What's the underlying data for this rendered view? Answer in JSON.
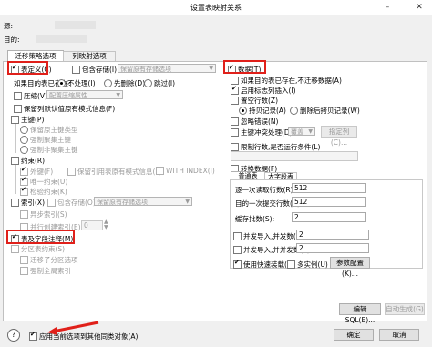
{
  "window": {
    "title": "设置表映射关系",
    "close_icon": "close-icon",
    "minimize_icon": "minimize-icon"
  },
  "header": {
    "source_label": "源:",
    "source_value": "",
    "target_label": "目的:",
    "target_value": ""
  },
  "tabs": [
    {
      "label": "迁移策略选项"
    },
    {
      "label": "列映射选项"
    }
  ],
  "left": {
    "table_def": {
      "label": "表定义(C)",
      "checked": true
    },
    "include_storage": {
      "label": "包含存储(I)",
      "select": "保留原有存储选项"
    },
    "if_exists_label": "如果目的表已存在:",
    "if_exists_options": [
      "不处理(I)",
      "先删除(D)",
      "跳过(I)"
    ],
    "compress": {
      "label": "压缩(V)",
      "select": "配置压缩属性..."
    },
    "keep_default": {
      "label": "保留列默认值原有模式信息(F)"
    },
    "primary_key": {
      "label": "主键(P)"
    },
    "primary_key_opts": [
      "保留原主键类型",
      "强制聚集主键",
      "强制非聚集主键"
    ],
    "constraint": {
      "label": "约束(R)"
    },
    "constraint_opts": [
      {
        "label": "外键(F)"
      },
      {
        "label": "保留引用表原有模式信息(F)"
      },
      {
        "label": "WITH INDEX(I)"
      },
      {
        "label": "唯一约束(U)"
      },
      {
        "label": "检验约束(K)"
      }
    ],
    "index": {
      "label": "索引(X)",
      "include_storage": "包含存储(O)",
      "select": "保留原有存储选项"
    },
    "index_opts": [
      "异步索引(S)",
      "并行创建索引(E)"
    ],
    "index_parallel_value": "0",
    "table_comment": {
      "label": "表及字段注释(M)",
      "checked": true
    },
    "partition": {
      "label": "分区表约束(S)"
    },
    "partition_opts": [
      "迁移子分区选项",
      "强制全局索引"
    ]
  },
  "right": {
    "data": {
      "label": "数据(T)",
      "checked": true
    },
    "opts": [
      {
        "label": "如果目的表已存在,不迁移数据(A)",
        "checked": false
      },
      {
        "label": "启用标志列插入(I)",
        "checked": true
      },
      {
        "label": "置空行数(Z)",
        "checked": false
      }
    ],
    "radio_opts": [
      "持贝记录(A)",
      "删除后拷贝记录(W)"
    ],
    "ignore_error": {
      "label": "忽略错误(N)"
    },
    "conflict": {
      "label": "主键冲突处理(D):",
      "select": "覆盖",
      "button": "指定列(C)..."
    },
    "limit_rows": {
      "label": "限制行数,是否运行条件(L)"
    },
    "convert_data": {
      "label": "转换数据(F)"
    },
    "subtabs": [
      "普通表",
      "大字段表"
    ],
    "fields": [
      {
        "label": "逐一次读取行数(R):",
        "value": "512"
      },
      {
        "label": "目的一次提交行数(B):",
        "value": "512"
      },
      {
        "label": "缓存批数(S):",
        "value": "2"
      }
    ],
    "parallel": [
      {
        "label": "并发导入,并发数(#):",
        "value": "2"
      },
      {
        "label": "并发导入,并并发数(E):",
        "value": "2"
      }
    ],
    "batch": {
      "label": "使用快速装载(U)",
      "multi": "多实例(U)",
      "button": "参数配置(K)..."
    }
  },
  "buttons": {
    "edit_sql": "编辑SQL(E)...",
    "auto_gen": "自动生成(G)",
    "ok": "确定",
    "cancel": "取消"
  },
  "footer": {
    "help_icon": "help-icon",
    "apply_label": "应用当前选项到其他同类对象(A)",
    "apply_checked": true
  },
  "colors": {
    "highlight": "#e0201a",
    "accent": "#0078d7"
  }
}
